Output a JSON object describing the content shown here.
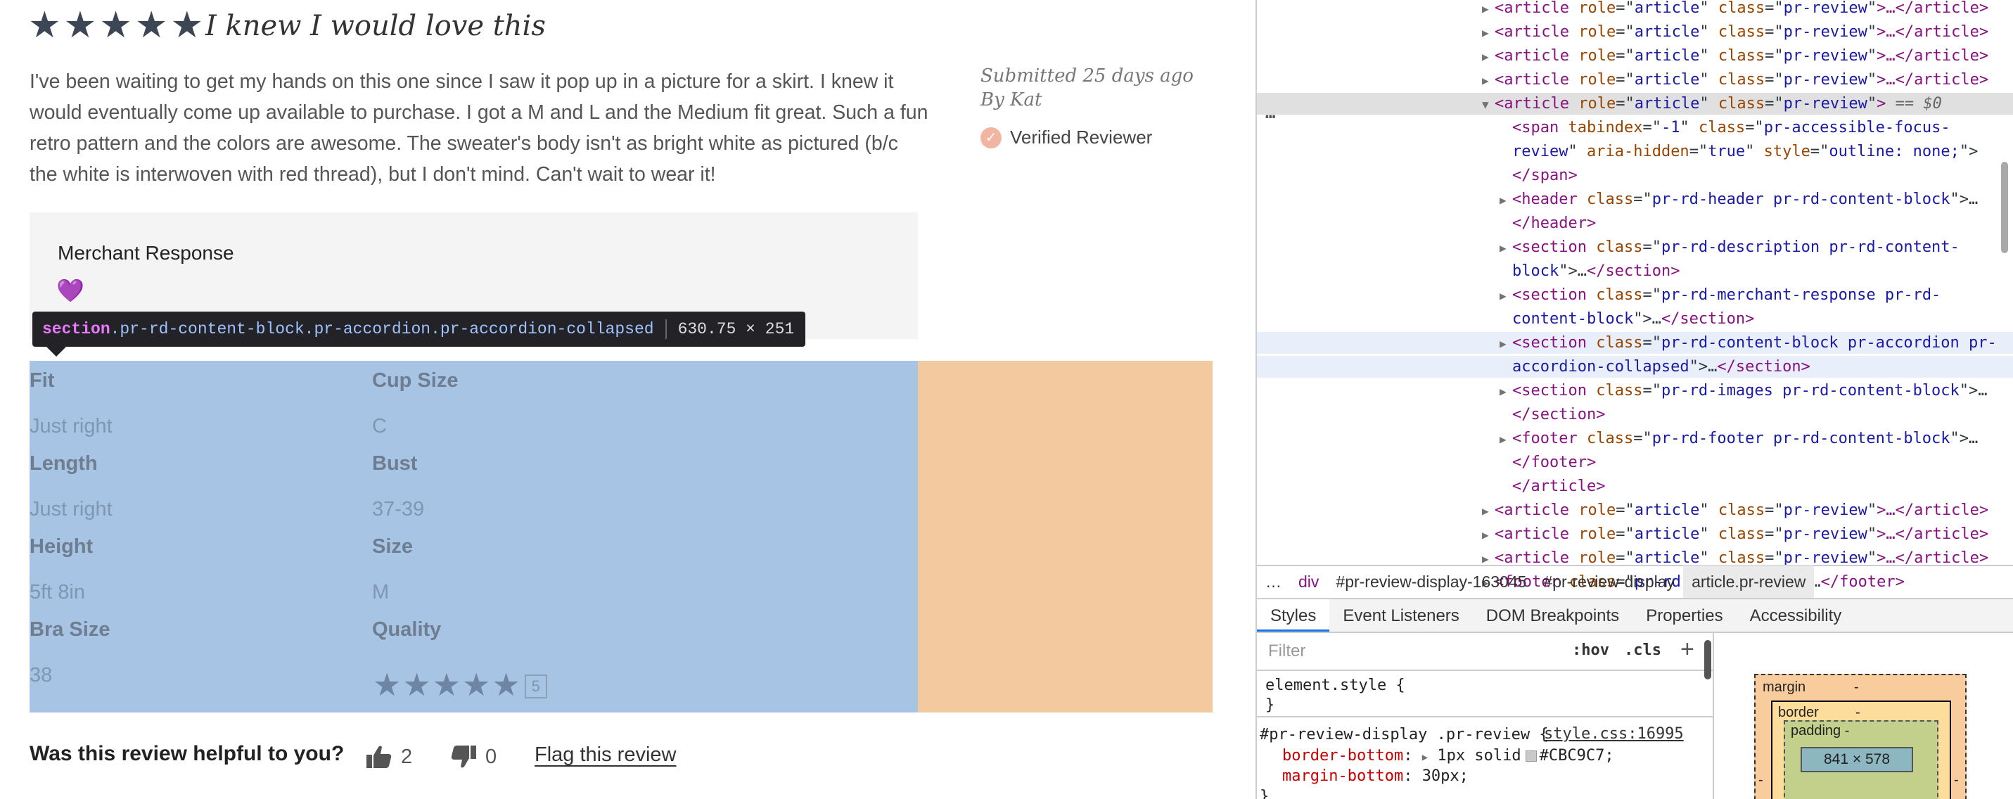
{
  "review": {
    "rating": 5,
    "headline": "I knew I would love this",
    "description": "I've been waiting to get my hands on this one since I saw it pop up in a picture for a skirt. I knew it would eventually come up available to purchase. I got a M and L and the Medium fit great. Such a fun retro pattern and the colors are awesome. The sweater's body isn't as bright white as pictured (b/c the white is interwoven with red thread), but I don't mind. Can't wait to wear it!",
    "submitted": "Submitted 25 days ago",
    "author": "By Kat",
    "verified": "Verified Reviewer",
    "merchant_title": "Merchant Response",
    "merchant_body": "💜",
    "attributes": [
      {
        "label": "Fit",
        "value": "Just right"
      },
      {
        "label": "Cup Size",
        "value": "C"
      },
      {
        "label": "Length",
        "value": "Just right"
      },
      {
        "label": "Bust",
        "value": "37-39"
      },
      {
        "label": "Height",
        "value": "5ft 8in"
      },
      {
        "label": "Size",
        "value": "M"
      },
      {
        "label": "Bra Size",
        "value": "38"
      },
      {
        "label": "Quality",
        "value": ""
      }
    ],
    "quality_rating": 5,
    "quality_count": "5",
    "helpful_question": "Was this review helpful to you?",
    "helpful_yes": "2",
    "helpful_no": "0",
    "flag": "Flag this review"
  },
  "inspector_tooltip": {
    "tag": "section",
    "classes": ".pr-rd-content-block.pr-accordion.pr-accordion-collapsed",
    "dimensions": "630.75 × 251"
  },
  "devtools": {
    "dom_lines": [
      {
        "indent": 0,
        "tri": "▶",
        "tag": "article",
        "attrs": [
          [
            "role",
            "article"
          ],
          [
            "class",
            "pr-review"
          ]
        ],
        "suffix": ">…</article>",
        "state": ""
      },
      {
        "indent": 0,
        "tri": "▶",
        "tag": "article",
        "attrs": [
          [
            "role",
            "article"
          ],
          [
            "class",
            "pr-review"
          ]
        ],
        "suffix": ">…</article>",
        "state": ""
      },
      {
        "indent": 0,
        "tri": "▶",
        "tag": "article",
        "attrs": [
          [
            "role",
            "article"
          ],
          [
            "class",
            "pr-review"
          ]
        ],
        "suffix": ">…</article>",
        "state": ""
      },
      {
        "indent": 0,
        "tri": "▶",
        "tag": "article",
        "attrs": [
          [
            "role",
            "article"
          ],
          [
            "class",
            "pr-review"
          ]
        ],
        "suffix": ">…</article>",
        "state": ""
      },
      {
        "indent": 0,
        "tri": "▼",
        "tag": "article",
        "attrs": [
          [
            "role",
            "article"
          ],
          [
            "class",
            "pr-review"
          ]
        ],
        "suffix": ">",
        "eq": " == $0",
        "state": "selected"
      },
      {
        "indent": 1,
        "tri": "",
        "raw": [
          [
            "tg",
            "<span "
          ],
          [
            "an",
            "tabindex"
          ],
          [
            "pl",
            "=\""
          ],
          [
            "av",
            "-1"
          ],
          [
            "pl",
            "\" "
          ],
          [
            "an",
            "class"
          ],
          [
            "pl",
            "=\""
          ],
          [
            "av",
            "pr-accessible-focus-"
          ]
        ],
        "state": ""
      },
      {
        "indent": 1,
        "tri": "",
        "raw": [
          [
            "av",
            "review"
          ],
          [
            "pl",
            "\" "
          ],
          [
            "an",
            "aria-hidden"
          ],
          [
            "pl",
            "=\""
          ],
          [
            "av",
            "true"
          ],
          [
            "pl",
            "\" "
          ],
          [
            "an",
            "style"
          ],
          [
            "pl",
            "=\""
          ],
          [
            "av",
            "outline: none;"
          ],
          [
            "pl",
            "\">"
          ]
        ],
        "state": ""
      },
      {
        "indent": 1,
        "tri": "",
        "raw": [
          [
            "tg",
            "</span>"
          ]
        ],
        "state": ""
      },
      {
        "indent": 1,
        "tri": "▶",
        "raw": [
          [
            "tg",
            "<header "
          ],
          [
            "an",
            "class"
          ],
          [
            "pl",
            "=\""
          ],
          [
            "av",
            "pr-rd-header pr-rd-content-block"
          ],
          [
            "pl",
            "\">…"
          ]
        ],
        "state": ""
      },
      {
        "indent": 1,
        "tri": "",
        "raw": [
          [
            "tg",
            "</header>"
          ]
        ],
        "state": ""
      },
      {
        "indent": 1,
        "tri": "▶",
        "raw": [
          [
            "tg",
            "<section "
          ],
          [
            "an",
            "class"
          ],
          [
            "pl",
            "=\""
          ],
          [
            "av",
            "pr-rd-description pr-rd-content-"
          ]
        ],
        "state": ""
      },
      {
        "indent": 1,
        "tri": "",
        "raw": [
          [
            "av",
            "block"
          ],
          [
            "pl",
            "\">…"
          ],
          [
            "tg",
            "</section>"
          ]
        ],
        "state": ""
      },
      {
        "indent": 1,
        "tri": "▶",
        "raw": [
          [
            "tg",
            "<section "
          ],
          [
            "an",
            "class"
          ],
          [
            "pl",
            "=\""
          ],
          [
            "av",
            "pr-rd-merchant-response pr-rd-"
          ]
        ],
        "state": ""
      },
      {
        "indent": 1,
        "tri": "",
        "raw": [
          [
            "av",
            "content-block"
          ],
          [
            "pl",
            "\">…"
          ],
          [
            "tg",
            "</section>"
          ]
        ],
        "state": ""
      },
      {
        "indent": 1,
        "tri": "▶",
        "raw": [
          [
            "tg",
            "<section "
          ],
          [
            "an",
            "class"
          ],
          [
            "pl",
            "=\""
          ],
          [
            "av",
            "pr-rd-content-block pr-accordion pr-"
          ]
        ],
        "state": "hover"
      },
      {
        "indent": 1,
        "tri": "",
        "raw": [
          [
            "av",
            "accordion-collapsed"
          ],
          [
            "pl",
            "\">…"
          ],
          [
            "tg",
            "</section>"
          ]
        ],
        "state": "hover"
      },
      {
        "indent": 1,
        "tri": "▶",
        "raw": [
          [
            "tg",
            "<section "
          ],
          [
            "an",
            "class"
          ],
          [
            "pl",
            "=\""
          ],
          [
            "av",
            "pr-rd-images pr-rd-content-block"
          ],
          [
            "pl",
            "\">…"
          ]
        ],
        "state": ""
      },
      {
        "indent": 1,
        "tri": "",
        "raw": [
          [
            "tg",
            "</section>"
          ]
        ],
        "state": ""
      },
      {
        "indent": 1,
        "tri": "▶",
        "raw": [
          [
            "tg",
            "<footer "
          ],
          [
            "an",
            "class"
          ],
          [
            "pl",
            "=\""
          ],
          [
            "av",
            "pr-rd-footer pr-rd-content-block"
          ],
          [
            "pl",
            "\">…"
          ]
        ],
        "state": ""
      },
      {
        "indent": 1,
        "tri": "",
        "raw": [
          [
            "tg",
            "</footer>"
          ]
        ],
        "state": ""
      },
      {
        "indent": 1,
        "tri": "",
        "raw": [
          [
            "tg",
            "</article>"
          ]
        ],
        "state": ""
      },
      {
        "indent": 0,
        "tri": "▶",
        "tag": "article",
        "attrs": [
          [
            "role",
            "article"
          ],
          [
            "class",
            "pr-review"
          ]
        ],
        "suffix": ">…</article>",
        "state": ""
      },
      {
        "indent": 0,
        "tri": "▶",
        "tag": "article",
        "attrs": [
          [
            "role",
            "article"
          ],
          [
            "class",
            "pr-review"
          ]
        ],
        "suffix": ">…</article>",
        "state": ""
      },
      {
        "indent": 0,
        "tri": "▶",
        "tag": "article",
        "attrs": [
          [
            "role",
            "article"
          ],
          [
            "class",
            "pr-review"
          ]
        ],
        "suffix": ">…</article>",
        "state": ""
      },
      {
        "indent": 0,
        "tri": "▶",
        "raw": [
          [
            "tg",
            "<footer "
          ],
          [
            "an",
            "class"
          ],
          [
            "pl",
            "=\""
          ],
          [
            "av",
            "pr-rd-main-footer"
          ],
          [
            "pl",
            "\">…"
          ],
          [
            "tg",
            "</footer>"
          ]
        ],
        "state": ""
      }
    ],
    "more_dots": "…",
    "breadcrumbs": [
      "…",
      "div",
      "#pr-review-display-163045",
      "#pr-review-display",
      "article.pr-review"
    ],
    "tabs": [
      "Styles",
      "Event Listeners",
      "DOM Breakpoints",
      "Properties",
      "Accessibility"
    ],
    "filter_placeholder": "Filter",
    "hov": ":hov",
    "cls": ".cls",
    "plus": "+",
    "element_style_open": "element.style {",
    "element_style_close": "}",
    "rule_selector": "#pr-review-display .pr-review {",
    "rule_source": "style.css:16995",
    "rule_decl_1_name": "border-bottom",
    "rule_decl_1_value": "1px solid",
    "rule_decl_1_color": "#CBC9C7",
    "rule_decl_2_name": "margin-bottom",
    "rule_decl_2_value": "30px;",
    "rule_close": "}",
    "box_model": {
      "margin_label": "margin",
      "margin_top": "-",
      "border_label": "border",
      "border_top": "-",
      "padding_label": "padding -",
      "content": "841 × 578",
      "side": "-"
    }
  }
}
